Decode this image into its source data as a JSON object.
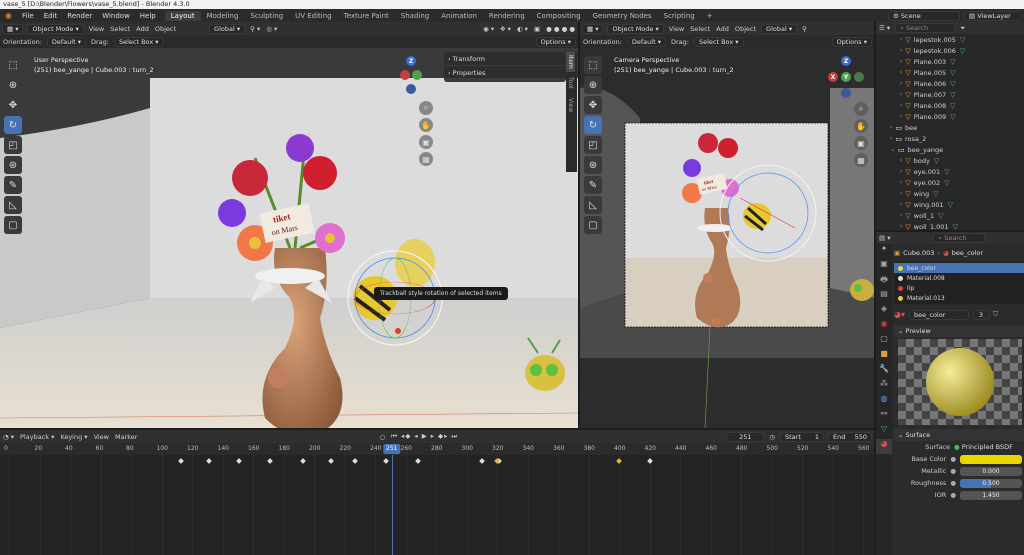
{
  "window": {
    "title": "vase_5 [D:\\Blender\\Flowers\\vase_5.blend] - Blender 4.3.0"
  },
  "menu": {
    "items": [
      "File",
      "Edit",
      "Render",
      "Window",
      "Help"
    ]
  },
  "workspaces": {
    "tabs": [
      "Layout",
      "Modeling",
      "Sculpting",
      "UV Editing",
      "Texture Paint",
      "Shading",
      "Animation",
      "Rendering",
      "Compositing",
      "Geometry Nodes",
      "Scripting"
    ],
    "active": "Layout",
    "add": "+"
  },
  "scene": {
    "label": "Scene",
    "view_layer": "ViewLayer"
  },
  "left_view": {
    "mode": "Object Mode",
    "menus": [
      "View",
      "Select",
      "Add",
      "Object"
    ],
    "transform": "Global",
    "orientation_label": "Orientation:",
    "orientation": "Default",
    "drag_label": "Drag:",
    "drag": "Select Box",
    "options": "Options",
    "perspective": "User Perspective",
    "info": "(251) bee_yange | Cube.003 : turn_2",
    "panel_transform": "Transform",
    "panel_properties": "Properties",
    "side_tabs": [
      "Item",
      "Tool",
      "View"
    ],
    "tooltip": "Trackball style rotation of selected items"
  },
  "right_view": {
    "mode": "Object Mode",
    "menus": [
      "View",
      "Select",
      "Add",
      "Object"
    ],
    "transform": "Global",
    "orientation_label": "Orientation:",
    "orientation": "Default",
    "drag_label": "Drag:",
    "drag": "Select Box",
    "options": "Options",
    "perspective": "Camera Perspective",
    "info": "(251) bee_yange | Cube.003 : turn_2"
  },
  "gizmo": {
    "x": "X",
    "y": "Y",
    "z": "Z"
  },
  "scene_art": {
    "sign_line1": "tiket",
    "sign_line2": "on Mars",
    "cam_sign_line1": "tiket",
    "cam_sign_line2": "on Mars"
  },
  "outliner": {
    "search_placeholder": "Search",
    "rows": [
      {
        "name": "lepestok.005",
        "indent": 2,
        "icon": "tri"
      },
      {
        "name": "lepestok.006",
        "indent": 2,
        "icon": "tri"
      },
      {
        "name": "Plane.003",
        "indent": 2,
        "icon": "tri"
      },
      {
        "name": "Plane.005",
        "indent": 2,
        "icon": "tri"
      },
      {
        "name": "Plane.006",
        "indent": 2,
        "icon": "tri"
      },
      {
        "name": "Plane.007",
        "indent": 2,
        "icon": "tri"
      },
      {
        "name": "Plane.008",
        "indent": 2,
        "icon": "tri"
      },
      {
        "name": "Plane.009",
        "indent": 2,
        "icon": "tri"
      },
      {
        "name": "bee",
        "indent": 1,
        "icon": "coll"
      },
      {
        "name": "rosa_2",
        "indent": 1,
        "icon": "coll"
      },
      {
        "name": "bee_yange",
        "indent": 1,
        "icon": "coll"
      },
      {
        "name": "body",
        "indent": 2,
        "icon": "tri"
      },
      {
        "name": "eye.001",
        "indent": 2,
        "icon": "tri"
      },
      {
        "name": "eye.002",
        "indent": 2,
        "icon": "tri"
      },
      {
        "name": "wing",
        "indent": 2,
        "icon": "tri"
      },
      {
        "name": "wing.001",
        "indent": 2,
        "icon": "tri"
      },
      {
        "name": "woll_1",
        "indent": 2,
        "icon": "tri"
      },
      {
        "name": "woll_1.001",
        "indent": 2,
        "icon": "tri"
      }
    ]
  },
  "properties": {
    "search_placeholder": "Search",
    "object": "Cube.003",
    "material": "bee_color",
    "slots": [
      {
        "name": "bee_color",
        "color": "#e8d94a",
        "selected": true
      },
      {
        "name": "Material.008",
        "color": "#dddddd",
        "selected": false
      },
      {
        "name": "lip",
        "color": "#e04040",
        "selected": false
      },
      {
        "name": "Material.013",
        "color": "#e8c84a",
        "selected": false
      }
    ],
    "material_field": "bee_color",
    "users": "3",
    "preview_label": "Preview",
    "surface_label": "Surface",
    "surface_key": "Surface",
    "surface_value": "Principled BSDF",
    "base_color_key": "Base Color",
    "base_color": "#e8d800",
    "metallic_key": "Metallic",
    "metallic": "0.000",
    "roughness_key": "Roughness",
    "roughness": "0.500",
    "roughness_fill": 0.5,
    "ior_key": "IOR",
    "ior": "1.450"
  },
  "timeline": {
    "menus": [
      "Playback",
      "Keying",
      "View",
      "Marker"
    ],
    "current": "251",
    "start_label": "Start",
    "start": "1",
    "end_label": "End",
    "end": "550",
    "ticks": [
      "0",
      "20",
      "40",
      "60",
      "80",
      "100",
      "120",
      "140",
      "160",
      "180",
      "200",
      "220",
      "240",
      "260",
      "280",
      "300",
      "320",
      "340",
      "360",
      "380",
      "400",
      "420",
      "440",
      "460",
      "480",
      "500",
      "520",
      "540",
      "560"
    ],
    "keyframes": [
      113,
      131,
      151,
      171,
      193,
      211,
      227,
      247,
      268,
      310,
      321,
      420
    ],
    "yellow_keyframes": [
      320,
      400
    ]
  }
}
